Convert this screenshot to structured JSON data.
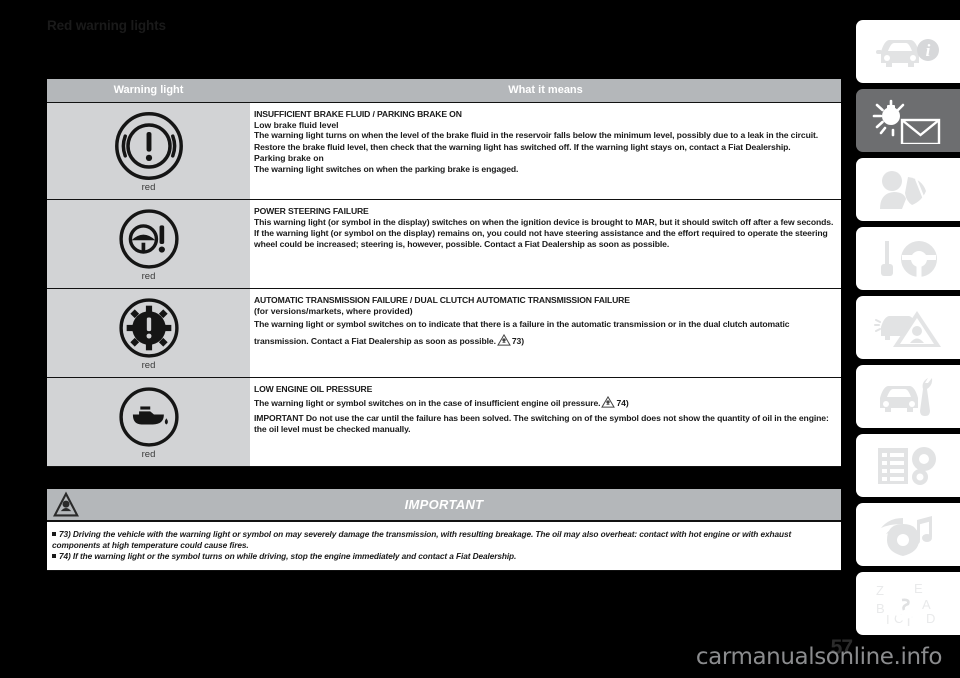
{
  "document": {
    "title": "Red warning lights",
    "page_number": "57",
    "watermark": "carmanualsonline.info"
  },
  "table": {
    "headers": {
      "warning_light": "Warning light",
      "what_it_means": "What it means"
    },
    "rows": [
      {
        "symbol": "brake-warning-symbol",
        "color_label": "red",
        "title": "INSUFFICIENT BRAKE FLUID / PARKING BRAKE ON",
        "subtitle": "Low brake fluid level",
        "body": "The warning light turns on when the level of the brake fluid in the reservoir falls below the minimum level, possibly due to a leak in the circuit. Restore the brake fluid level, then check that the warning light has switched off. If the warning light stays on, contact a Fiat Dealership.",
        "subtitle2": "Parking brake on",
        "body2": "The warning light switches on when the parking brake is engaged."
      },
      {
        "symbol": "power-steering-symbol",
        "color_label": "red",
        "title": "POWER STEERING FAILURE",
        "subtitle": "",
        "body": "This warning light (or symbol in the display) switches on when the ignition device is brought to MAR, but it should switch off after a few seconds. If the warning light (or symbol on the display) remains on, you could not have steering assistance and the effort required to operate the steering wheel could be increased; steering is, however, possible. Contact a Fiat Dealership as soon as possible.",
        "subtitle2": "",
        "body2": ""
      },
      {
        "symbol": "transmission-failure-symbol",
        "color_label": "red",
        "title": "AUTOMATIC TRANSMISSION FAILURE / DUAL CLUTCH AUTOMATIC TRANSMISSION FAILURE",
        "subtitle": "(for versions/markets, where provided)",
        "body": "The warning light or symbol switches on to indicate that there is a failure in the automatic transmission or in the dual clutch automatic transmission. Contact a Fiat Dealership as soon as possible.",
        "body_suffix": "73)",
        "subtitle2": "",
        "body2": ""
      },
      {
        "symbol": "low-oil-pressure-symbol",
        "color_label": "red",
        "title": "LOW ENGINE OIL PRESSURE",
        "subtitle": "",
        "body": "The warning light or symbol switches on in the case of insufficient engine oil pressure.",
        "body_suffix": "74)",
        "subtitle2": "",
        "body2": "IMPORTANT Do not use the car until the failure has been solved. The switching on of the symbol does not show the quantity of oil in the engine: the oil level must be checked manually."
      }
    ]
  },
  "important_box": {
    "title": "IMPORTANT",
    "icon": "warning-triangle-icon",
    "lines": [
      "73) Driving the vehicle with the warning light or symbol on may severely damage the transmission, with resulting breakage. The oil may also overheat: contact with hot engine or with exhaust components at high temperature could cause fires.",
      "74) If the warning light or the symbol turns on while driving, stop the engine immediately and contact a Fiat Dealership."
    ]
  },
  "sidebar": {
    "tabs": [
      {
        "name": "knowing-the-car",
        "icon": "car-info-icon",
        "active": false
      },
      {
        "name": "knowing-the-dashboard",
        "icon": "warning-light-envelope-icon",
        "active": true
      },
      {
        "name": "safety",
        "icon": "airbag-occupant-icon",
        "active": false
      },
      {
        "name": "starting-and-driving",
        "icon": "key-steering-wheel-icon",
        "active": false
      },
      {
        "name": "in-an-emergency",
        "icon": "car-hazard-triangle-icon",
        "active": false
      },
      {
        "name": "maintenance-and-care",
        "icon": "car-wrench-icon",
        "active": false
      },
      {
        "name": "technical-specifications",
        "icon": "list-gears-icon",
        "active": false
      },
      {
        "name": "multimedia",
        "icon": "radio-music-icon",
        "active": false
      },
      {
        "name": "alphabetical-index",
        "icon": "index-magnifier-icon",
        "active": false
      }
    ]
  },
  "colors": {
    "header_gray": "#b4b7ba",
    "symbol_cell_gray": "#d2d3d5",
    "active_tab_gray": "#6d6e70",
    "text_black": "#1a1a1a"
  }
}
